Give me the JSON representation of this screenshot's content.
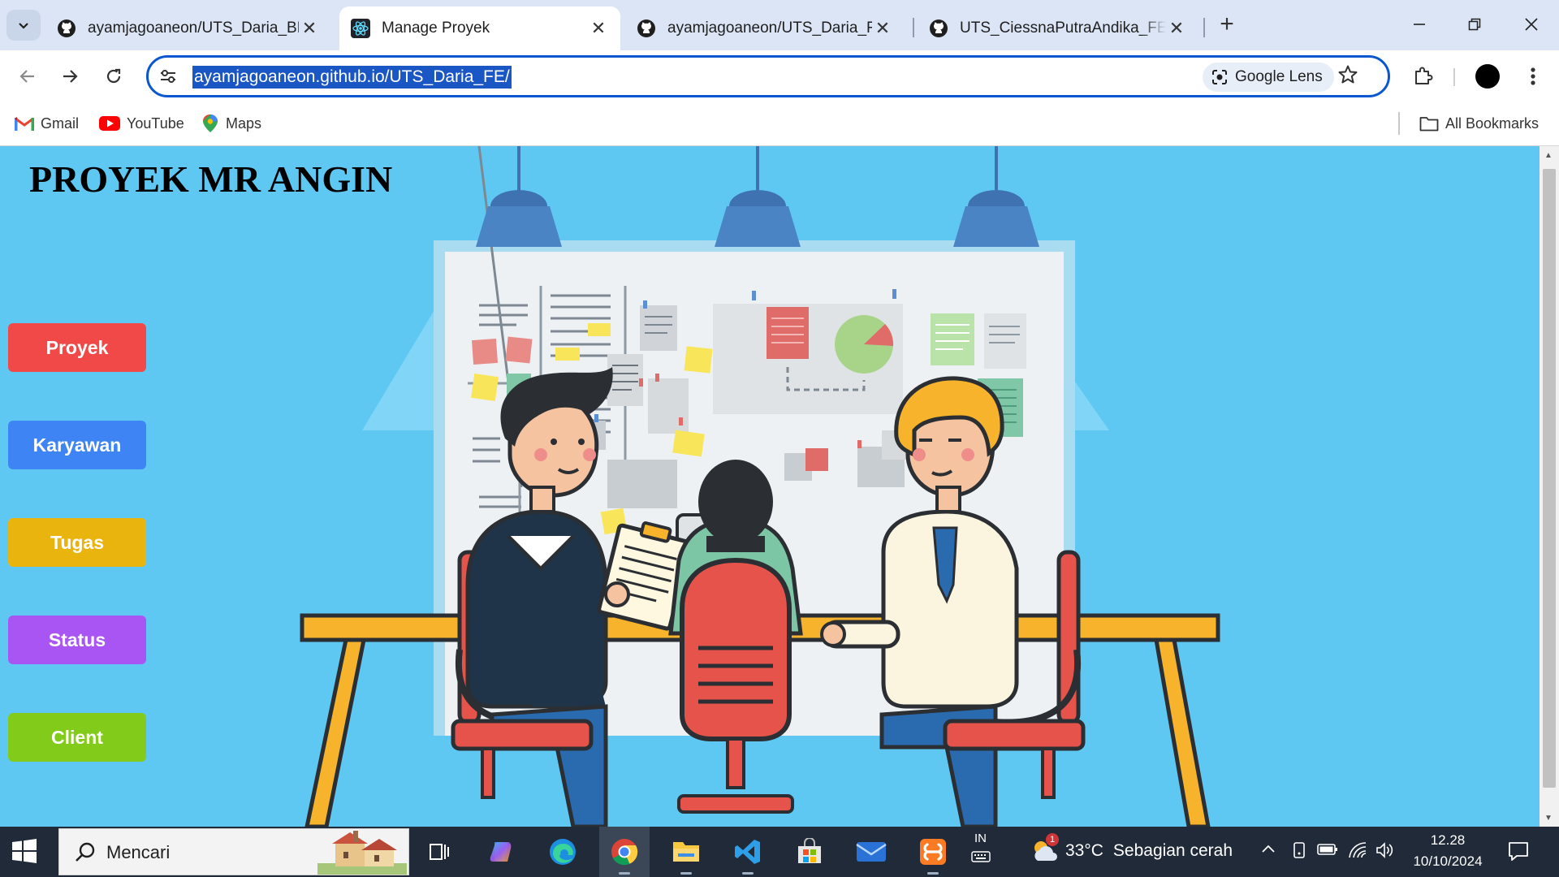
{
  "browser": {
    "tabs": [
      {
        "title": "ayamjagoaneon/UTS_Daria_BE",
        "favicon": "github-icon",
        "active": false
      },
      {
        "title": "Manage Proyek",
        "favicon": "react-icon",
        "active": true
      },
      {
        "title": "ayamjagoaneon/UTS_Daria_FE",
        "favicon": "github-icon",
        "active": false
      },
      {
        "title": "UTS_CiessnaPutraAndika_FE/README",
        "favicon": "github-icon",
        "active": false
      }
    ],
    "close_glyph": "✕",
    "new_tab_glyph": "+",
    "url": "ayamjagoaneon.github.io/UTS_Daria_FE/",
    "google_lens_label": "Google Lens",
    "bookmarks": [
      {
        "label": "Gmail",
        "icon": "gmail-icon"
      },
      {
        "label": "YouTube",
        "icon": "youtube-icon"
      },
      {
        "label": "Maps",
        "icon": "maps-icon"
      }
    ],
    "all_bookmarks_label": "All Bookmarks"
  },
  "page": {
    "title": "PROYEK MR ANGIN",
    "nav_buttons": [
      {
        "label": "Proyek",
        "color": "#f14848"
      },
      {
        "label": "Karyawan",
        "color": "#3f84f4"
      },
      {
        "label": "Tugas",
        "color": "#eab40f"
      },
      {
        "label": "Status",
        "color": "#a955f3"
      },
      {
        "label": "Client",
        "color": "#83cb1a"
      }
    ],
    "illustration": "office-meeting-illustration"
  },
  "taskbar": {
    "search_placeholder": "Mencari",
    "weather": {
      "temperature": "33°C",
      "condition": "Sebagian cerah",
      "alert_count": "1"
    },
    "language": "IN",
    "time": "12.28",
    "date": "10/10/2024",
    "apps": [
      "task-view-icon",
      "copilot-icon",
      "edge-icon",
      "chrome-icon",
      "file-explorer-icon",
      "vscode-icon",
      "microsoft-store-icon",
      "mail-icon",
      "xampp-icon"
    ]
  },
  "colors": {
    "page_background": "#5ec8f3",
    "omnibox_border": "#0b57d0",
    "url_highlight": "#1a56c4",
    "taskbar": "#202a38"
  }
}
